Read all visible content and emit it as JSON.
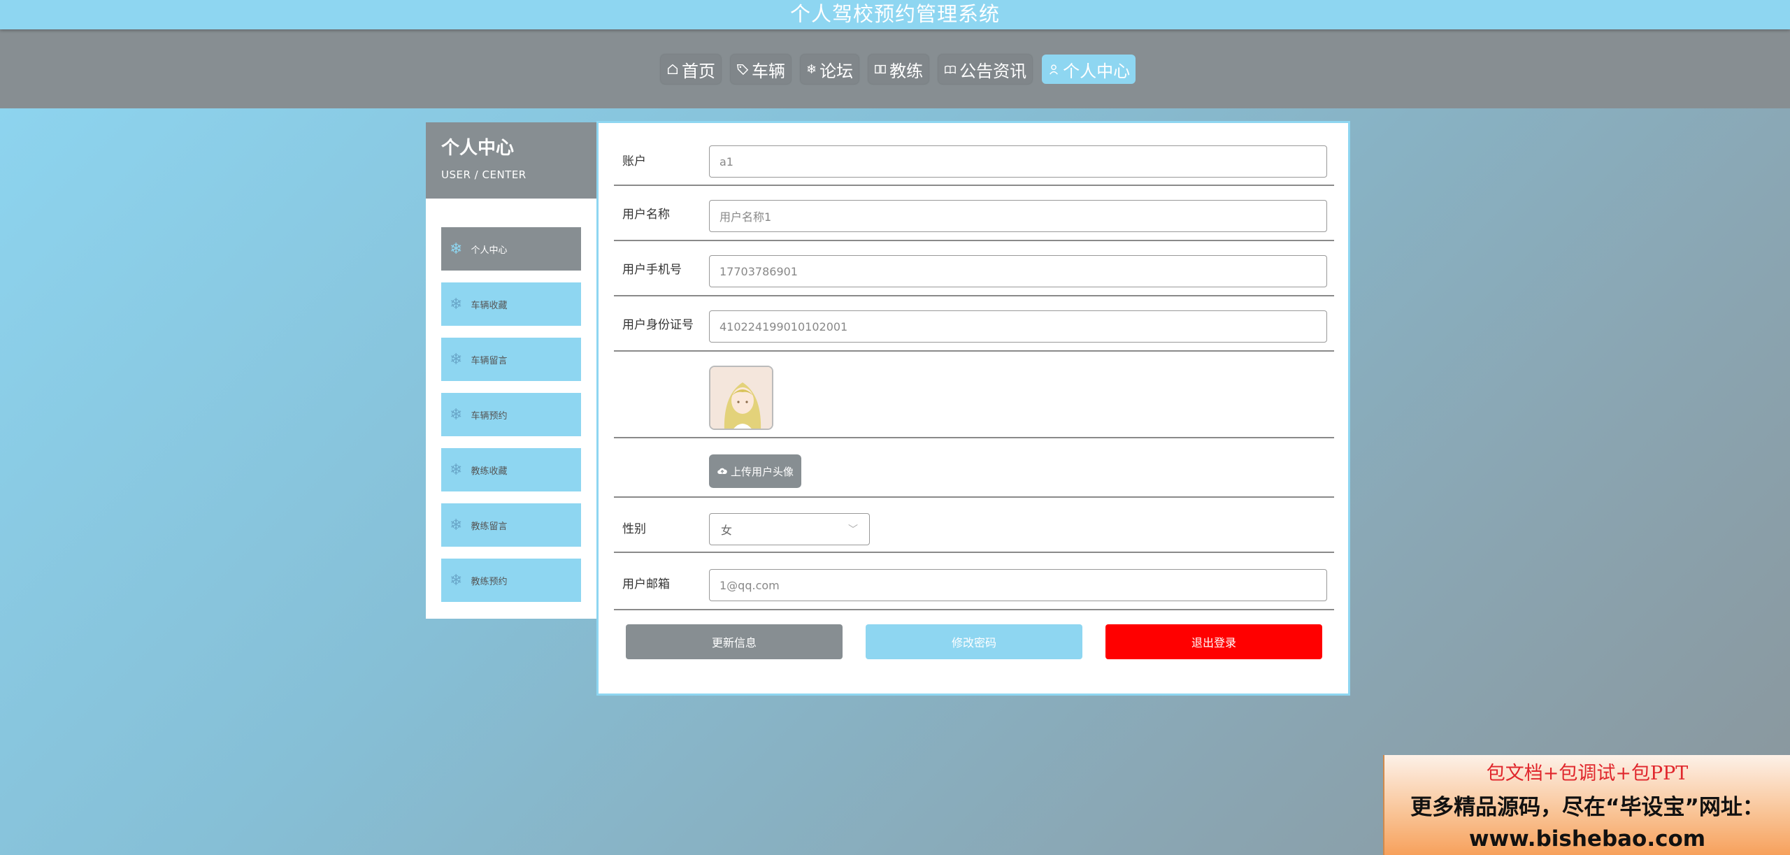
{
  "app": {
    "title": "个人驾校预约管理系统"
  },
  "nav": [
    {
      "label": "首页",
      "icon": "home-icon",
      "active": false
    },
    {
      "label": "车辆",
      "icon": "tag-icon",
      "active": false
    },
    {
      "label": "论坛",
      "icon": "snowflake-icon",
      "active": false
    },
    {
      "label": "教练",
      "icon": "book-icon",
      "active": false
    },
    {
      "label": "公告资讯",
      "icon": "news-icon",
      "active": false
    },
    {
      "label": "个人中心",
      "icon": "user-icon",
      "active": true
    }
  ],
  "sidebar": {
    "title": "个人中心",
    "subtitle": "USER / CENTER",
    "items": [
      {
        "label": "个人中心",
        "active": true
      },
      {
        "label": "车辆收藏",
        "active": false
      },
      {
        "label": "车辆留言",
        "active": false
      },
      {
        "label": "车辆预约",
        "active": false
      },
      {
        "label": "教练收藏",
        "active": false
      },
      {
        "label": "教练留言",
        "active": false
      },
      {
        "label": "教练预约",
        "active": false
      }
    ]
  },
  "form": {
    "account": {
      "label": "账户",
      "value": "a1"
    },
    "username": {
      "label": "用户名称",
      "value": "用户名称1"
    },
    "phone": {
      "label": "用户手机号",
      "value": "17703786901"
    },
    "idcard": {
      "label": "用户身份证号",
      "value": "410224199010102001"
    },
    "upload_label": "上传用户头像",
    "gender": {
      "label": "性别",
      "value": "女"
    },
    "email": {
      "label": "用户邮箱",
      "value": "1@qq.com"
    }
  },
  "buttons": {
    "update": "更新信息",
    "password": "修改密码",
    "logout": "退出登录"
  },
  "colors": {
    "primary": "#8ed6f1",
    "secondary": "#878e92",
    "danger": "#ff0000"
  },
  "watermark": {
    "line1": "包文档+包调试+包PPT",
    "line2": "更多精品源码，尽在“毕设宝”网址：",
    "line3": "www.bishebao.com"
  }
}
